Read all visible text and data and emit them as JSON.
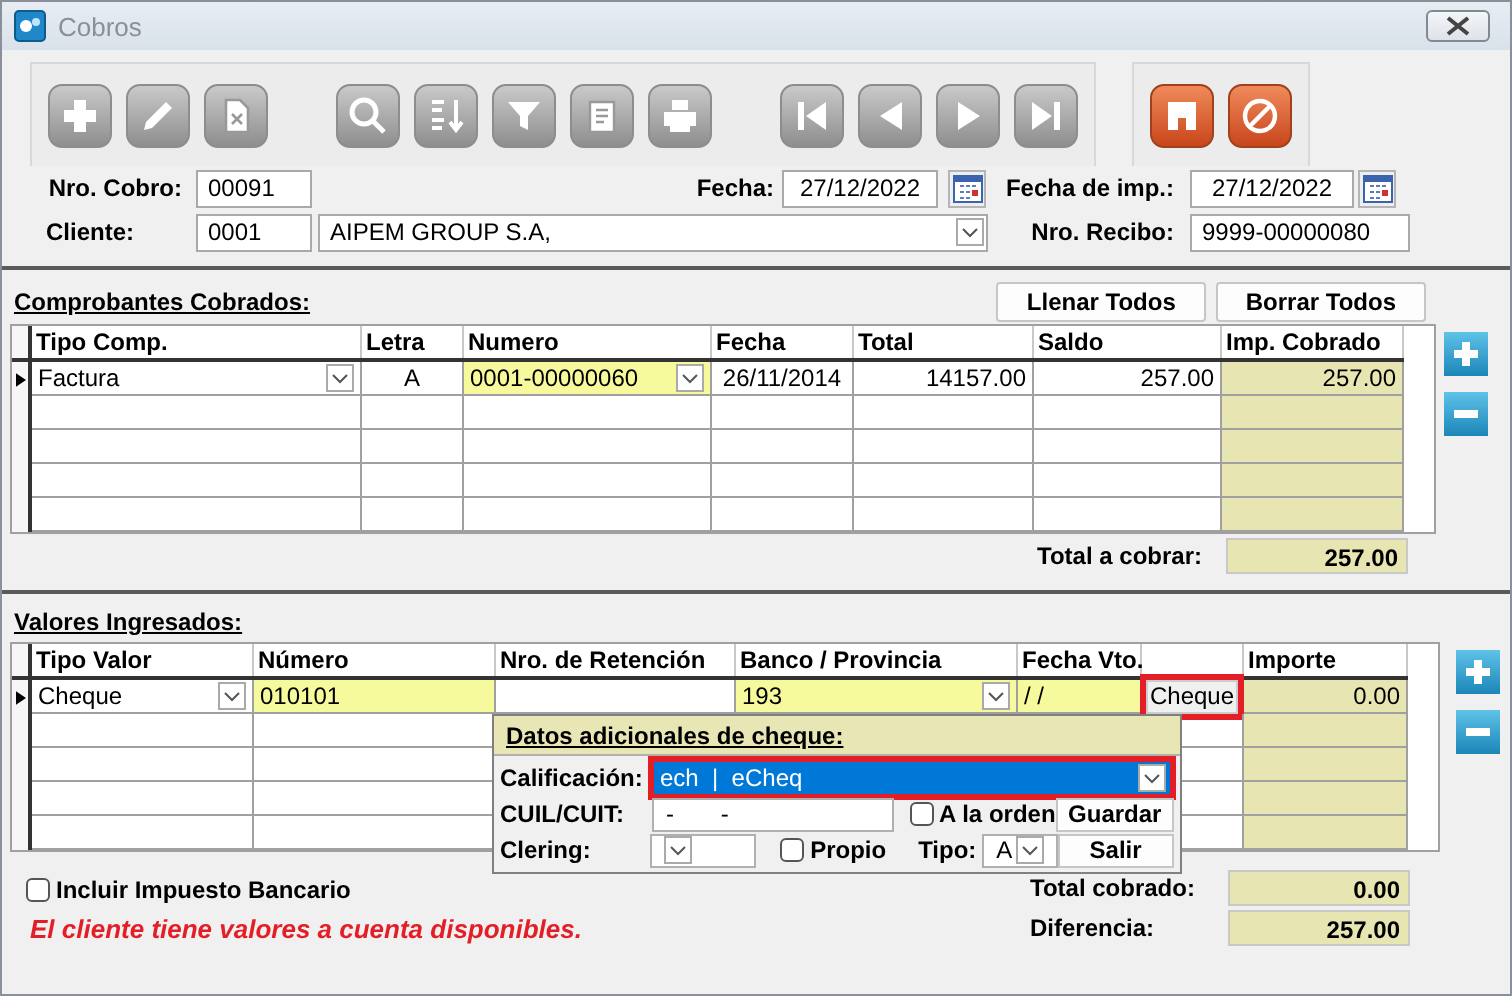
{
  "window": {
    "title": "Cobros"
  },
  "header": {
    "nro_cobro": {
      "label": "Nro. Cobro:",
      "value": "00091"
    },
    "fecha": {
      "label": "Fecha:",
      "value": "27/12/2022"
    },
    "fecha_imp": {
      "label": "Fecha de imp.:",
      "value": "27/12/2022"
    },
    "cliente": {
      "label": "Cliente:",
      "code": "0001",
      "name": "AIPEM GROUP S.A,"
    },
    "nro_recibo": {
      "label": "Nro. Recibo:",
      "value": "9999-00000080"
    }
  },
  "comprobantes": {
    "title": "Comprobantes Cobrados:",
    "buttons": [
      "Llenar Todos",
      "Borrar Todos"
    ],
    "columns": [
      {
        "label": "Tipo Comp.",
        "kind": "combo"
      },
      {
        "label": "Letra",
        "kind": "center"
      },
      {
        "label": "Numero",
        "kind": "input_combo"
      },
      {
        "label": "Fecha",
        "kind": "center"
      },
      {
        "label": "Total",
        "kind": "number"
      },
      {
        "label": "Saldo",
        "kind": "number"
      },
      {
        "label": "Imp. Cobrado",
        "kind": "sum"
      }
    ],
    "rows": [
      {
        "current": true,
        "cells": [
          "Factura",
          "A",
          "0001-00000060",
          "26/11/2014",
          "14157.00",
          "257.00",
          "257.00"
        ]
      }
    ],
    "total": {
      "label": "Total a cobrar:",
      "value": "257.00"
    }
  },
  "valores": {
    "title": "Valores Ingresados:",
    "columns": [
      {
        "label": "Tipo Valor",
        "kind": "combo"
      },
      {
        "label": "Número",
        "kind": "input"
      },
      {
        "label": "Nro. de Retención",
        "kind": "text"
      },
      {
        "label": "Banco / Provincia",
        "kind": "input_combo"
      },
      {
        "label": "Fecha Vto.",
        "kind": "input"
      },
      {
        "kind": "button"
      },
      {
        "label": "Importe",
        "kind": "sum"
      }
    ],
    "rows": [
      {
        "current": true,
        "highlighted": true,
        "cells": [
          "Cheque",
          "010101",
          "",
          "193",
          "/ /",
          "Cheque",
          "0.00"
        ]
      }
    ],
    "popup": {
      "title": "Datos adicionales de cheque:",
      "calificacion": {
        "label": "Calificación:",
        "value": "ech  |  eCheq",
        "highlighted": true
      },
      "cuil": {
        "label": "CUIL/CUIT:",
        "value": "-       -"
      },
      "a_la_orden": {
        "label": "A la orden",
        "checked": false
      },
      "clering": {
        "label": "Clering:"
      },
      "propio": {
        "label": "Propio",
        "checked": false
      },
      "tipo": {
        "label": "Tipo:",
        "value": "A"
      },
      "buttons": [
        "Guardar",
        "Salir"
      ]
    },
    "incluir_impuesto": {
      "label": "Incluir Impuesto Bancario",
      "checked": false
    },
    "message": "El cliente tiene valores a cuenta disponibles.",
    "totals": [
      {
        "label": "Total cobrado:",
        "value": "0.00"
      },
      {
        "label": "Diferencia:",
        "value": "257.00"
      }
    ]
  }
}
